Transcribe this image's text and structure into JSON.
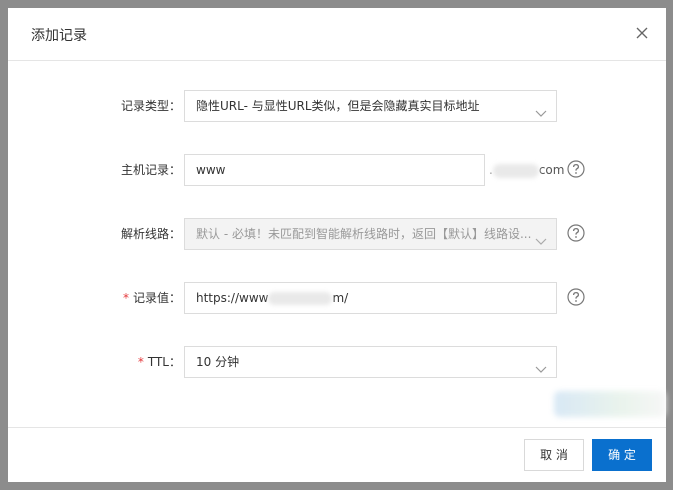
{
  "dialog": {
    "title": "添加记录",
    "close_icon": "close-icon"
  },
  "form": {
    "record_type": {
      "label": "记录类型：",
      "value": "隐性URL- 与显性URL类似，但是会隐藏真实目标地址"
    },
    "host": {
      "label": "主机记录：",
      "value": "www",
      "suffix_end": "com"
    },
    "line": {
      "label": "解析线路：",
      "value": "默认 - 必填！未匹配到智能解析线路时，返回【默认】线路设..."
    },
    "record_value": {
      "label": "记录值：",
      "value_start": "https://www",
      "value_end": "m/"
    },
    "ttl": {
      "label": "TTL：",
      "value": "10 分钟"
    },
    "required_mark": "*"
  },
  "footer": {
    "cancel_label": "取 消",
    "ok_label": "确 定"
  },
  "colors": {
    "primary": "#0a70ce",
    "required": "#e4393c"
  }
}
